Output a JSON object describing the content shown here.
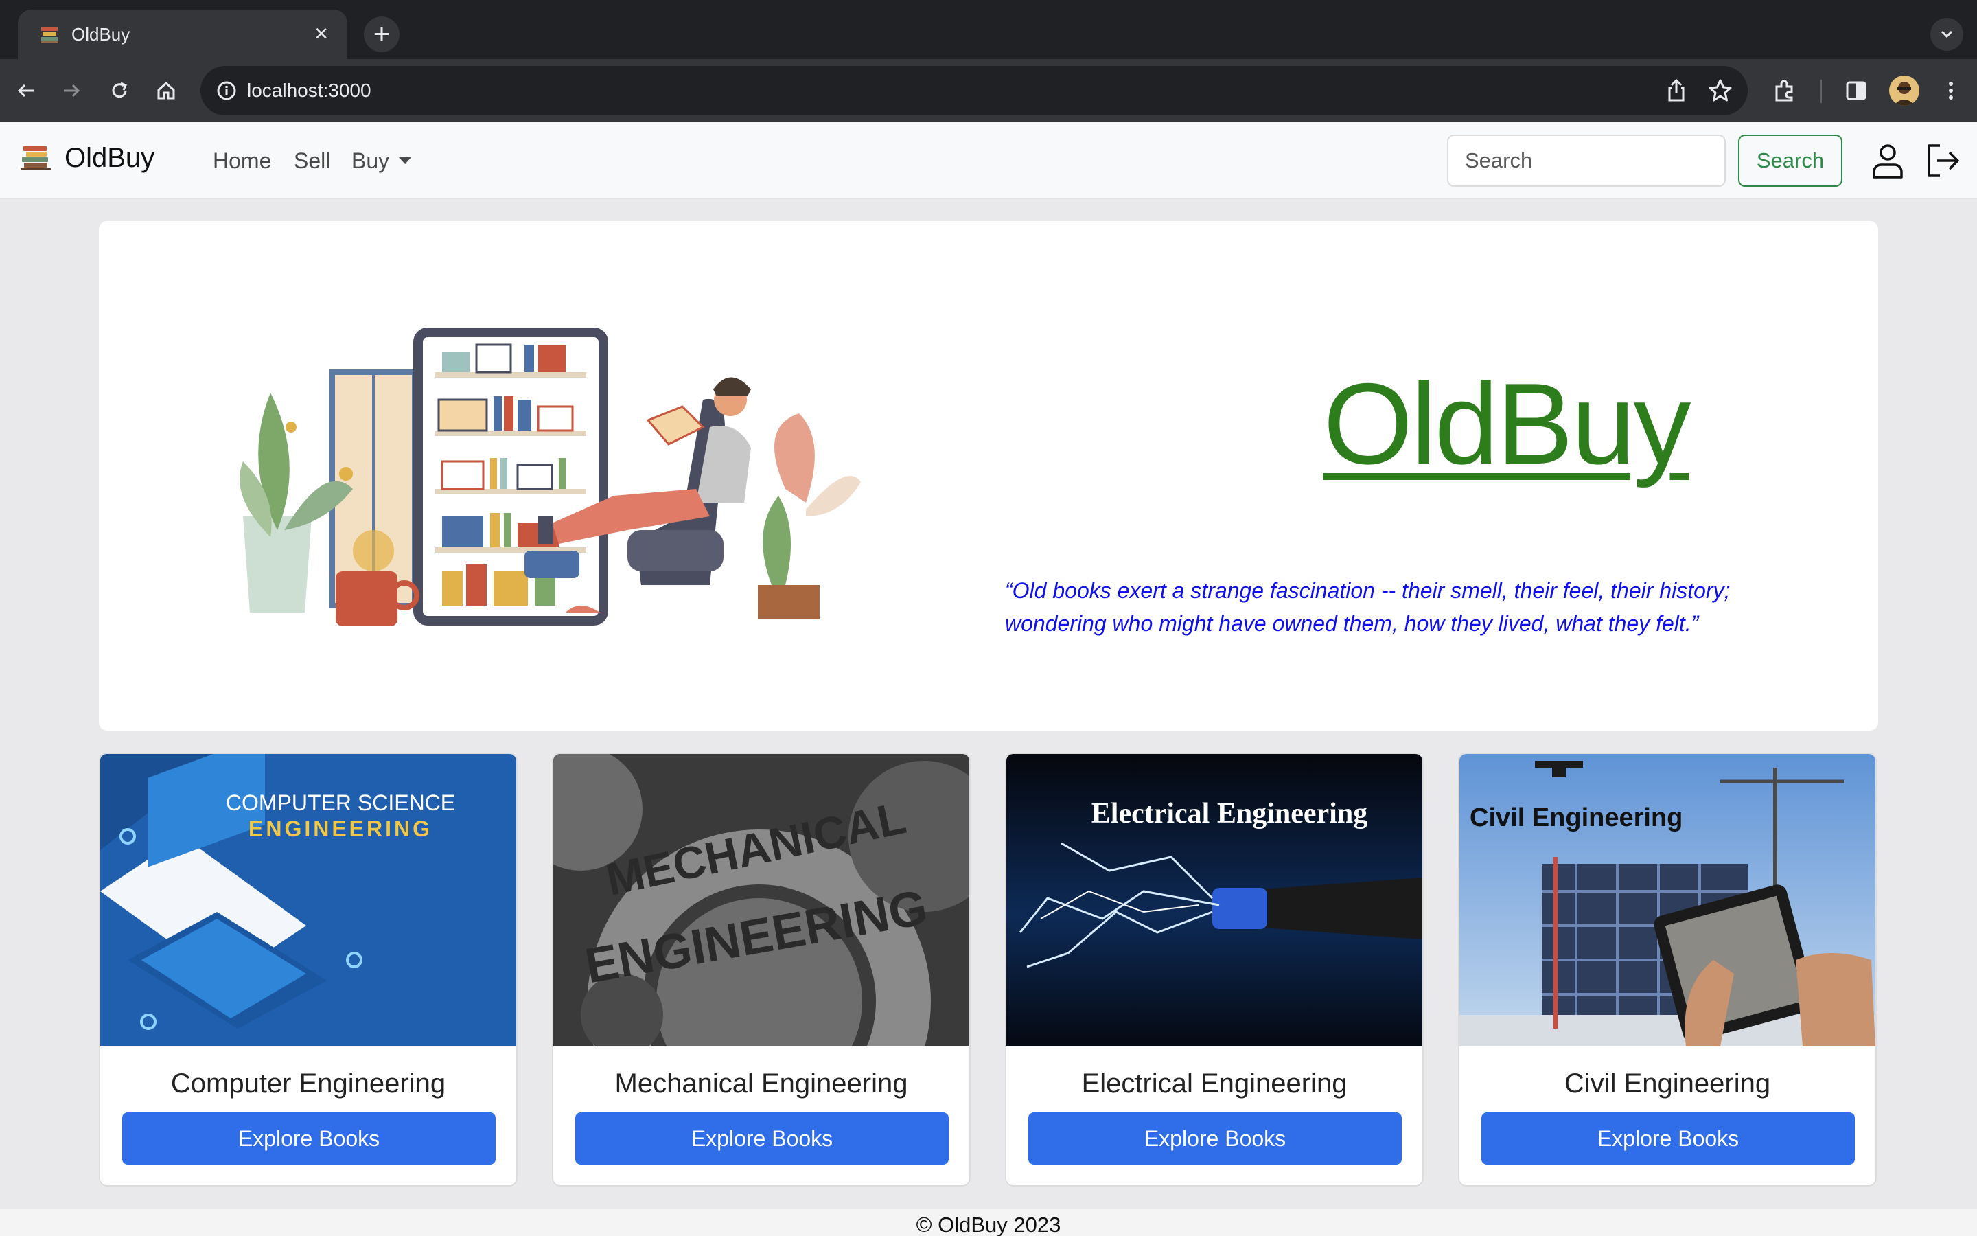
{
  "browser": {
    "tab_title": "OldBuy",
    "new_tab_icon": "plus-icon",
    "close_icon": "close-icon",
    "url": "localhost:3000",
    "icons": [
      "back-icon",
      "forward-icon",
      "reload-icon",
      "home-icon",
      "info-icon",
      "share-icon",
      "star-icon",
      "extensions-icon",
      "sidepanel-icon",
      "profile-avatar",
      "menu-icon"
    ]
  },
  "navbar": {
    "brand": "OldBuy",
    "links": [
      "Home",
      "Sell",
      "Buy"
    ],
    "search_placeholder": "Search",
    "search_button": "Search",
    "icons": [
      "user-icon",
      "logout-icon"
    ]
  },
  "hero": {
    "title": "OldBuy",
    "quote": "“Old books exert a strange fascination -- their smell, their feel, their history; wondering who might have owned them, how they lived, what they felt.”"
  },
  "cards": [
    {
      "title": "Computer Engineering",
      "button": "Explore Books",
      "image_text_1": "COMPUTER SCIENCE",
      "image_text_2": "ENGINEERING"
    },
    {
      "title": "Mechanical Engineering",
      "button": "Explore Books",
      "image_text_1": "MECHANICAL",
      "image_text_2": "ENGINEERING"
    },
    {
      "title": "Electrical Engineering",
      "button": "Explore Books",
      "image_text_1": "Electrical Engineering"
    },
    {
      "title": "Civil Engineering",
      "button": "Explore Books",
      "image_text_1": "Civil Engineering"
    }
  ],
  "footer": {
    "text": "© OldBuy 2023"
  },
  "colors": {
    "primary": "#2f6ee8",
    "brand_green": "#2e7d1c",
    "quote_blue": "#1010ee",
    "success": "#2f8a4a"
  }
}
